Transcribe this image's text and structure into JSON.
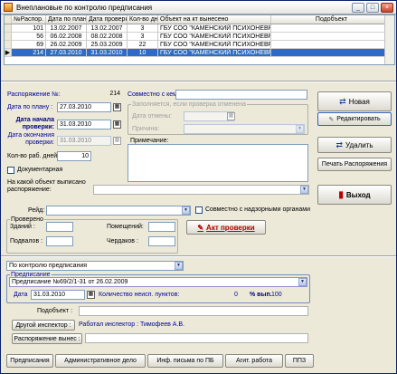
{
  "window": {
    "title": "Внеплановые по контролю предписания",
    "min": "_",
    "max": "□",
    "close": "×"
  },
  "grid": {
    "columns": [
      "№Распор.",
      "Дата по плану",
      "Дата проверки",
      "Кол-во дней",
      "Объект на кт вынесено",
      "Подобъект"
    ],
    "rows": [
      {
        "ind": "",
        "n": "101",
        "d1": "13.02.2007",
        "d2": "13.02.2007",
        "k": "3",
        "obj": "ГБУ СОО \"КАМЕНСКИЙ ПСИХОНЕВРОЛОГ",
        "sub": ""
      },
      {
        "ind": "",
        "n": "56",
        "d1": "06.02.2008",
        "d2": "08.02.2008",
        "k": "3",
        "obj": "ГБУ СОО \"КАМЕНСКИЙ ПСИХОНЕВРОЛОГ",
        "sub": ""
      },
      {
        "ind": "",
        "n": "69",
        "d1": "26.02.2009",
        "d2": "25.03.2009",
        "k": "22",
        "obj": "ГБУ СОО \"КАМЕНСКИЙ ПСИХОНЕВРОЛОГ",
        "sub": ""
      },
      {
        "ind": "▶",
        "n": "214",
        "d1": "27.03.2010",
        "d2": "31.03.2010",
        "k": "10",
        "obj": "ГБУ СОО \"КАМЕНСКИЙ ПСИХОНЕВРОЛОГ",
        "sub": ""
      }
    ]
  },
  "form": {
    "rasp_label": "Распоряжение №:",
    "rasp_value": "214",
    "plan_label": "Дата по плану :",
    "plan_value": "27.03.2010",
    "start_label": "Дата начала проверки:",
    "start_value": "31.03.2010",
    "end_label": "Дата окончания проверки:",
    "end_value": "31.03.2010",
    "days_label": "Кол-во раб. дней:",
    "days_value": "10",
    "doc_label": "Документарная",
    "obj_label": "На какой объект выписано распоряжение:",
    "with_label": "Совместно с кем:",
    "cancel_note": "Заполняется, если проверка отменена",
    "cancel_date_label": "Дата отмены:",
    "reason_label": "Причина:",
    "note_label": "Примечание:",
    "raid_label": "Рейд:",
    "joint_label": "Совместно с надзорными органами",
    "checked_label": "Проверено",
    "build_label": "Зданий :",
    "rooms_label": "Помещений:",
    "basement_label": "Подвалов :",
    "attic_label": "Чердаков :",
    "act_button": "Акт проверки",
    "control_value": "По контролю предписания",
    "predpis_label": "Предписание",
    "predpis_value": "Предписание №69/2/1-31 от 26.02.2009",
    "date_label": "Дата",
    "date_value": "31.03.2010",
    "unfulfilled_label": "Количество неисп. пунктов:",
    "unfulfilled_value": "0",
    "pct_label": "% вып.",
    "pct_value": "100",
    "subobj_label": "Подобъект :",
    "other_insp_button": "Другой инспектор :",
    "insp_text": "Работал инспектор : Тимофеев А.В.",
    "issued_label": "Распоряжение вынес :"
  },
  "side": {
    "new": "Новая",
    "edit": "Редактировать",
    "delete": "Удалить",
    "print": "Печать Распоряжения",
    "exit": "Выход"
  },
  "bottom": [
    "Предписания",
    "Административное дело",
    "Инф. письма по ПБ",
    "Агит. работа",
    "ППЗ"
  ]
}
